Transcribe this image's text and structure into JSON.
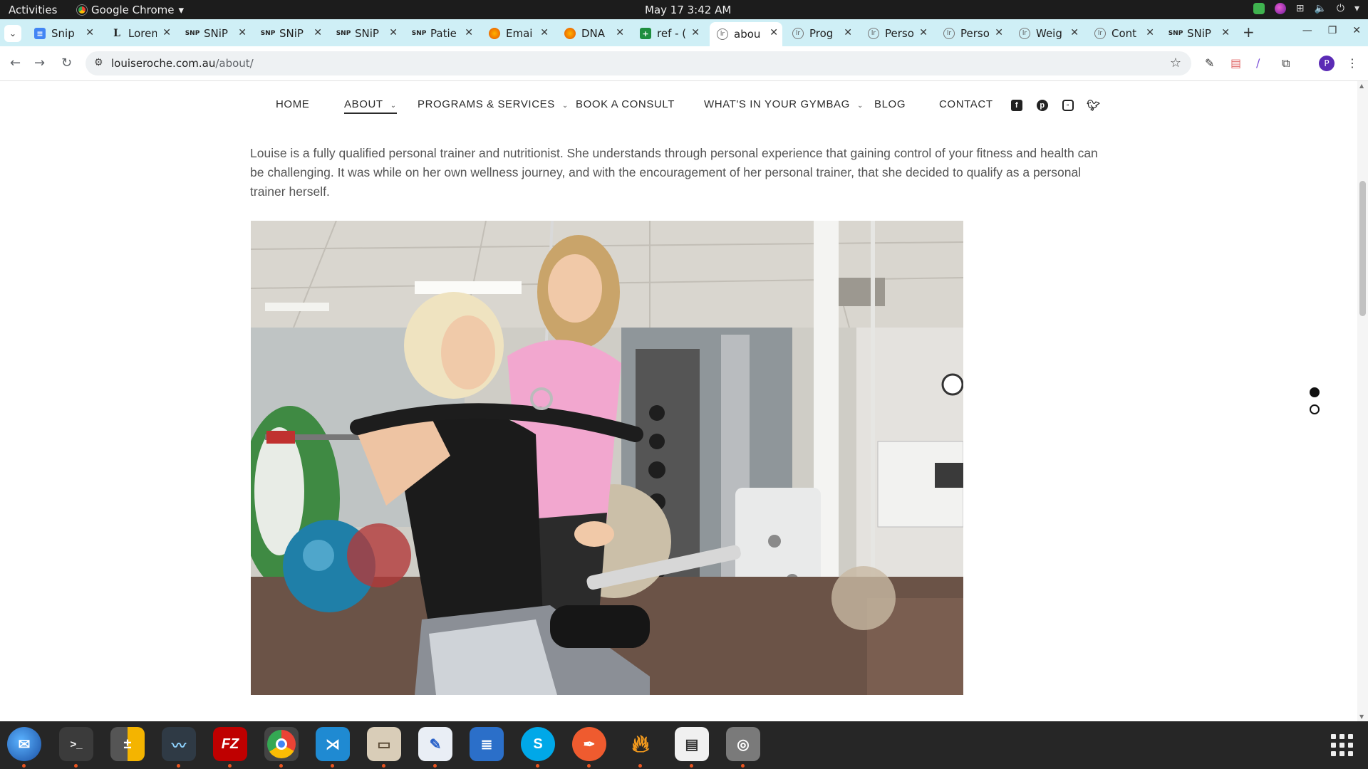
{
  "system": {
    "activities": "Activities",
    "app_name": "Google Chrome",
    "clock": "May 17  3:42 AM"
  },
  "tabs": [
    {
      "title": "Snip",
      "icon": "google-docs-icon"
    },
    {
      "title": "Lorem",
      "icon": "lorem-L-icon"
    },
    {
      "title": "SNiP",
      "icon": "snip-icon"
    },
    {
      "title": "SNiP",
      "icon": "snip-icon"
    },
    {
      "title": "SNiP",
      "icon": "snip-icon"
    },
    {
      "title": "Patie",
      "icon": "snip-icon"
    },
    {
      "title": "Emai",
      "icon": "email-icon"
    },
    {
      "title": "DNA",
      "icon": "email-icon"
    },
    {
      "title": "ref - (",
      "icon": "google-sheets-icon"
    },
    {
      "title": "abou",
      "icon": "louiseroche-icon"
    },
    {
      "title": "Prog",
      "icon": "louiseroche-icon"
    },
    {
      "title": "Perso",
      "icon": "louiseroche-icon"
    },
    {
      "title": "Perso",
      "icon": "louiseroche-icon"
    },
    {
      "title": "Weig",
      "icon": "louiseroche-icon"
    },
    {
      "title": "Cont",
      "icon": "louiseroche-icon"
    },
    {
      "title": "SNiP",
      "icon": "snip-icon"
    }
  ],
  "address_bar": {
    "domain": "louiseroche.com.au",
    "path": "/about/"
  },
  "site_nav": {
    "home": "HOME",
    "about": "ABOUT",
    "programs": "PROGRAMS & SERVICES",
    "book": "BOOK A CONSULT",
    "gymbag": "WHAT'S IN YOUR GYMBAG",
    "blog": "BLOG",
    "contact": "CONTACT"
  },
  "intro_text": "Louise is a fully qualified personal trainer and nutritionist.  She understands through personal experience that gaining control of your fitness and health can be challenging. It was while on her own wellness journey, and with the encouragement of her personal trainer, that she decided to qualify as a personal trainer herself.",
  "dock_apps": [
    "thunderbird",
    "terminal",
    "calculator",
    "system-monitor",
    "filezilla",
    "google-chrome",
    "vs-code",
    "files",
    "text-editor",
    "libreoffice-writer",
    "skype",
    "inkscape-pen",
    "blaze",
    "document-viewer",
    "disk-utility"
  ]
}
